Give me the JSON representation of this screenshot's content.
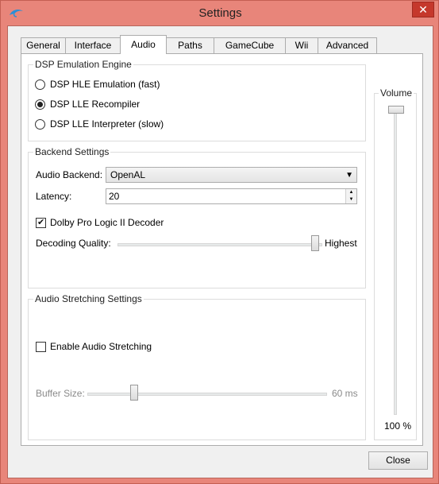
{
  "window": {
    "title": "Settings",
    "icon": "dolphin-icon",
    "close_glyph": "✕"
  },
  "tabs": [
    "General",
    "Interface",
    "Audio",
    "Paths",
    "GameCube",
    "Wii",
    "Advanced"
  ],
  "active_tab": "Audio",
  "dsp": {
    "group_label": "DSP Emulation Engine",
    "options": [
      "DSP HLE Emulation (fast)",
      "DSP LLE Recompiler",
      "DSP LLE Interpreter (slow)"
    ],
    "selected_index": 1
  },
  "backend": {
    "group_label": "Backend Settings",
    "audio_backend_label": "Audio Backend:",
    "audio_backend_value": "OpenAL",
    "latency_label": "Latency:",
    "latency_value": "20",
    "dolby_label": "Dolby Pro Logic II Decoder",
    "dolby_checked": true,
    "decoding_quality_label": "Decoding Quality:",
    "decoding_quality_value": "Highest",
    "decoding_quality_level": 1.0
  },
  "stretching": {
    "group_label": "Audio Stretching Settings",
    "enable_label": "Enable Audio Stretching",
    "enable_checked": false,
    "buffer_size_label": "Buffer Size:",
    "buffer_size_value": "60 ms",
    "buffer_size_level": 0.2
  },
  "volume": {
    "group_label": "Volume",
    "value": "100 %",
    "level": 1.0
  },
  "close_button": "Close",
  "colors": {
    "titlebar": "#e8857a",
    "close_x": "#c5382c"
  }
}
